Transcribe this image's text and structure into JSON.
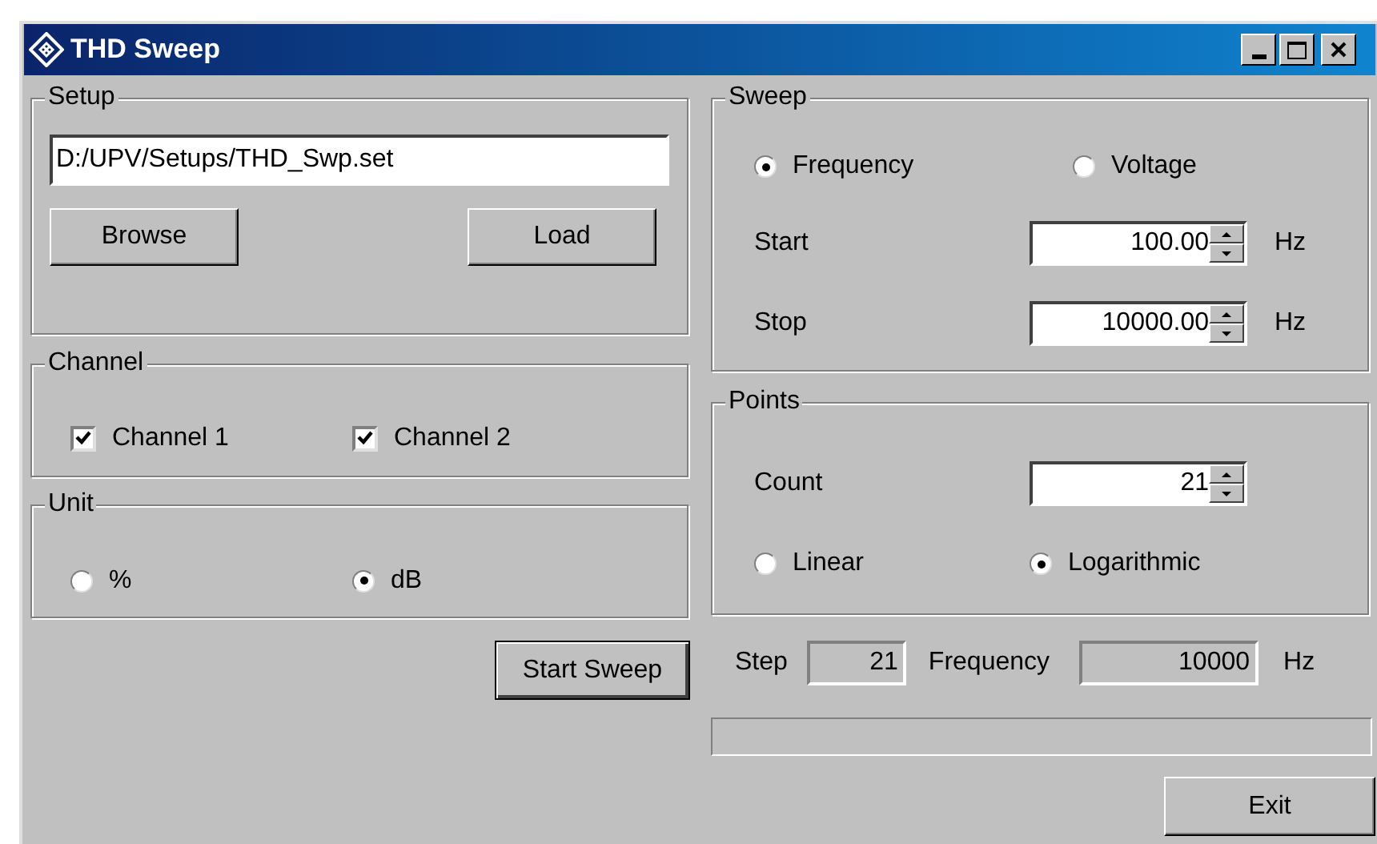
{
  "window": {
    "title": "THD Sweep"
  },
  "setup": {
    "title": "Setup",
    "path": "D:/UPV/Setups/THD_Swp.set",
    "buttons": [
      "Browse",
      "Load"
    ]
  },
  "channel": {
    "title": "Channel",
    "items": [
      {
        "label": "Channel 1",
        "checked": true
      },
      {
        "label": "Channel 2",
        "checked": true
      }
    ]
  },
  "unit": {
    "title": "Unit",
    "options": [
      {
        "label": "%",
        "selected": false
      },
      {
        "label": "dB",
        "selected": true
      }
    ]
  },
  "start_button": "Start Sweep",
  "sweep": {
    "title": "Sweep",
    "options": [
      {
        "label": "Frequency",
        "selected": true
      },
      {
        "label": "Voltage",
        "selected": false
      }
    ],
    "fields": [
      {
        "label": "Start",
        "value": "100.00",
        "unit": "Hz"
      },
      {
        "label": "Stop",
        "value": "10000.00",
        "unit": "Hz"
      }
    ]
  },
  "points": {
    "title": "Points",
    "count": {
      "label": "Count",
      "value": "21"
    },
    "options": [
      {
        "label": "Linear",
        "selected": false
      },
      {
        "label": "Logarithmic",
        "selected": true
      }
    ]
  },
  "status": {
    "step_label": "Step",
    "step_value": "21",
    "frequency_label": "Frequency",
    "frequency_value": "10000",
    "unit": "Hz"
  },
  "progress": {
    "level": 0
  },
  "exit_button": "Exit"
}
